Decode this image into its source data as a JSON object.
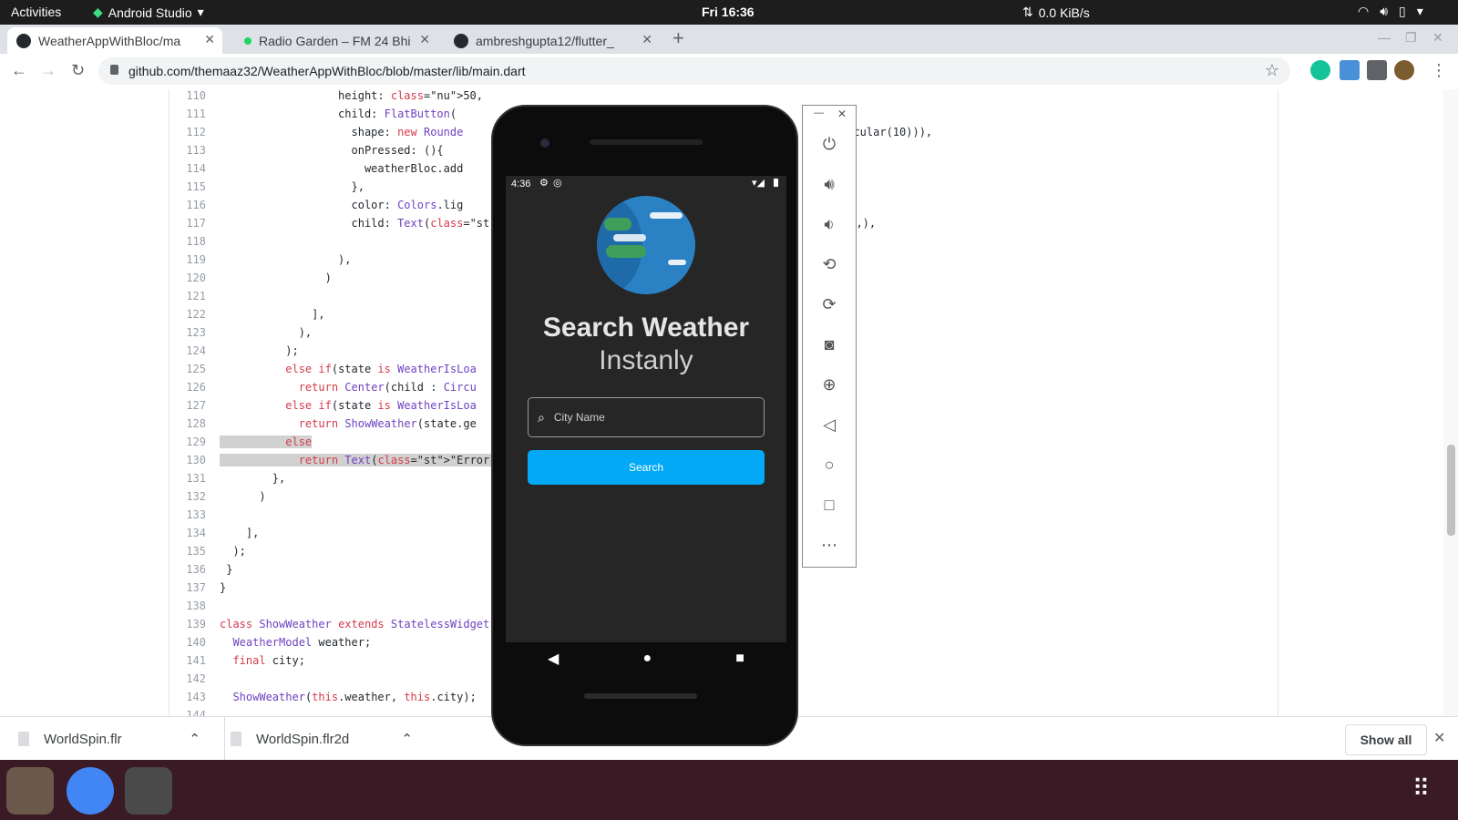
{
  "topbar": {
    "activities": "Activities",
    "app": "Android Studio",
    "clock": "Fri 16:36",
    "net": "0.0 KiB/s"
  },
  "tabs": [
    {
      "title": "WeatherAppWithBloc/ma",
      "active": true
    },
    {
      "title": "Radio Garden – FM 24 Bhi",
      "active": false
    },
    {
      "title": "ambreshgupta12/flutter_",
      "active": false
    }
  ],
  "address": {
    "url": "github.com/themaaz32/WeatherAppWithBloc/blob/master/lib/main.dart"
  },
  "code": {
    "lines": [
      {
        "n": "110",
        "text": "                  height: 50,"
      },
      {
        "n": "111",
        "text": "                  child: FlatButton("
      },
      {
        "n": "112",
        "text": "                    shape: new Rounde"
      },
      {
        "n": "113",
        "text": "                    onPressed: (){"
      },
      {
        "n": "114",
        "text": "                      weatherBloc.add"
      },
      {
        "n": "115",
        "text": "                    },"
      },
      {
        "n": "116",
        "text": "                    color: Colors.lig"
      },
      {
        "n": "117",
        "text": "                    child: Text(\"Sear"
      },
      {
        "n": "118",
        "text": ""
      },
      {
        "n": "119",
        "text": "                  ),"
      },
      {
        "n": "120",
        "text": "                )"
      },
      {
        "n": "121",
        "text": ""
      },
      {
        "n": "122",
        "text": "              ],"
      },
      {
        "n": "123",
        "text": "            ),"
      },
      {
        "n": "124",
        "text": "          );"
      },
      {
        "n": "125",
        "text": "          else if(state is WeatherIsLoa"
      },
      {
        "n": "126",
        "text": "            return Center(child : Circu"
      },
      {
        "n": "127",
        "text": "          else if(state is WeatherIsLoa"
      },
      {
        "n": "128",
        "text": "            return ShowWeather(state.ge"
      },
      {
        "n": "129",
        "text": "          else"
      },
      {
        "n": "130",
        "text": "            return Text(\"Error\",style:"
      },
      {
        "n": "131",
        "text": "        },"
      },
      {
        "n": "132",
        "text": "      )"
      },
      {
        "n": "133",
        "text": ""
      },
      {
        "n": "134",
        "text": "    ],"
      },
      {
        "n": "135",
        "text": "  );"
      },
      {
        "n": "136",
        "text": " }"
      },
      {
        "n": "137",
        "text": "}"
      },
      {
        "n": "138",
        "text": ""
      },
      {
        "n": "139",
        "text": "class ShowWeather extends StatelessWidget"
      },
      {
        "n": "140",
        "text": "  WeatherModel weather;"
      },
      {
        "n": "141",
        "text": "  final city;"
      },
      {
        "n": "142",
        "text": ""
      },
      {
        "n": "143",
        "text": "  ShowWeather(this.weather, this.city);"
      },
      {
        "n": "144",
        "text": ""
      }
    ],
    "right_fragments": [
      {
        "line": "112",
        "text": "ircular(10))),"
      },
      {
        "line": "117",
        "text": "6),),"
      }
    ]
  },
  "downloads": [
    {
      "name": "WorldSpin.flr"
    },
    {
      "name": "WorldSpin.flr2d"
    }
  ],
  "show_all": "Show all",
  "emulator": {
    "time": "4:36",
    "title": "Search Weather",
    "subtitle": "Instanly",
    "search_placeholder": "City Name",
    "button": "Search",
    "accent": "#03a9f4"
  }
}
